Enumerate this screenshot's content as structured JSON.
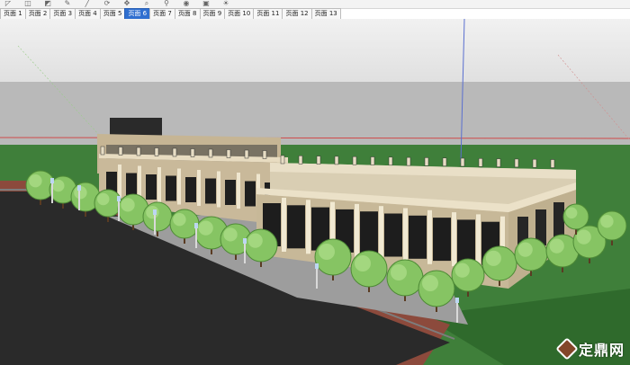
{
  "tabs": [
    {
      "label": "页面 1",
      "active": false
    },
    {
      "label": "页面 2",
      "active": false
    },
    {
      "label": "页面 3",
      "active": false
    },
    {
      "label": "页面 4",
      "active": false
    },
    {
      "label": "页面 5",
      "active": false
    },
    {
      "label": "页面 6",
      "active": true
    },
    {
      "label": "页面 7",
      "active": false
    },
    {
      "label": "页面 8",
      "active": false
    },
    {
      "label": "页面 9",
      "active": false
    },
    {
      "label": "页面 10",
      "active": false
    },
    {
      "label": "页面 11",
      "active": false
    },
    {
      "label": "页面 12",
      "active": false
    },
    {
      "label": "页面 13",
      "active": false
    }
  ],
  "toolbar_icons": [
    "select-icon",
    "eraser-icon",
    "paint-icon",
    "pencil-icon",
    "line-icon",
    "orbit-icon",
    "pan-icon",
    "zoom-icon",
    "walk-icon",
    "look-icon",
    "section-icon",
    "shadow-icon"
  ],
  "watermark": {
    "brand": "定鼎网",
    "logo_icon": "dingding-logo-icon"
  },
  "colors": {
    "tab_active": "#2f6fd0",
    "sky": "#e8e8e8",
    "ground": "#3d7d3a",
    "road": "#2d2d2d",
    "building": "#c9b99a",
    "tree": "#7dbf5a"
  }
}
